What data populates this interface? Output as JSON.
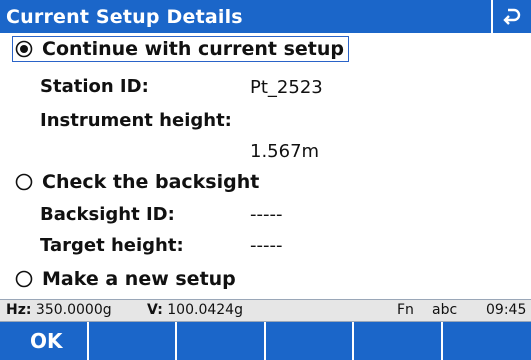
{
  "header": {
    "title": "Current Setup Details",
    "back_icon": "return-arrow-icon"
  },
  "options": {
    "continue": {
      "label": "Continue with current setup",
      "selected": true
    },
    "check": {
      "label": "Check the backsight",
      "selected": false
    },
    "new": {
      "label": "Make a new setup",
      "selected": false
    }
  },
  "fields": {
    "station_id": {
      "label": "Station ID:",
      "value": "Pt_2523"
    },
    "instrument_height": {
      "label": "Instrument height:",
      "value": "1.567m"
    },
    "backsight_id": {
      "label": "Backsight ID:",
      "value": "-----"
    },
    "target_height": {
      "label": "Target height:",
      "value": "-----"
    }
  },
  "status": {
    "hz_label": "Hz:",
    "hz_value": "350.0000g",
    "v_label": "V:",
    "v_value": "100.0424g",
    "fn": "Fn",
    "mode": "abc",
    "time": "09:45"
  },
  "softkeys": [
    "OK",
    "",
    "",
    "",
    "",
    ""
  ],
  "colors": {
    "accent": "#1b66c9",
    "statusbar": "#e6e6e6"
  }
}
